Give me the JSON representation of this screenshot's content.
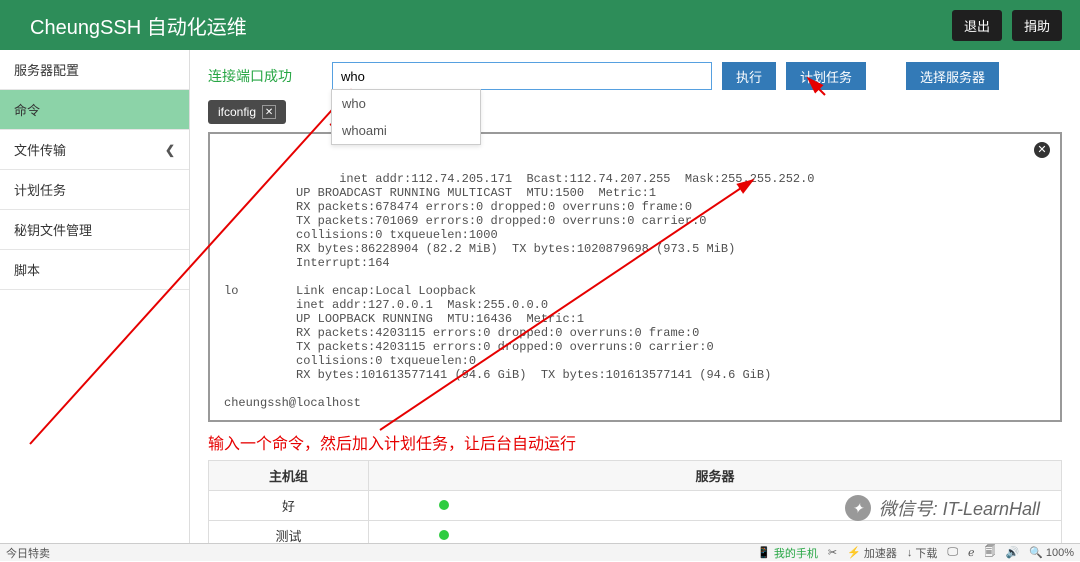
{
  "header": {
    "brand": "CheungSSH 自动化运维",
    "logout": "退出",
    "donate": "捐助"
  },
  "sidebar": {
    "items": [
      {
        "label": "服务器配置"
      },
      {
        "label": "命令",
        "active": true
      },
      {
        "label": "文件传输",
        "expand": true
      },
      {
        "label": "计划任务"
      },
      {
        "label": "秘钥文件管理"
      },
      {
        "label": "脚本"
      }
    ]
  },
  "top": {
    "status": "连接端口成功",
    "input_value": "who",
    "run": "执行",
    "sched": "计划任务",
    "select_server": "选择服务器"
  },
  "autocomplete": [
    "who",
    "whoami"
  ],
  "tag": {
    "label": "ifconfig"
  },
  "terminal_text": "          inet addr:112.74.205.171  Bcast:112.74.207.255  Mask:255.255.252.0\n          UP BROADCAST RUNNING MULTICAST  MTU:1500  Metric:1\n          RX packets:678474 errors:0 dropped:0 overruns:0 frame:0\n          TX packets:701069 errors:0 dropped:0 overruns:0 carrier:0\n          collisions:0 txqueuelen:1000\n          RX bytes:86228904 (82.2 MiB)  TX bytes:1020879698 (973.5 MiB)\n          Interrupt:164\n\nlo        Link encap:Local Loopback\n          inet addr:127.0.0.1  Mask:255.0.0.0\n          UP LOOPBACK RUNNING  MTU:16436  Metric:1\n          RX packets:4203115 errors:0 dropped:0 overruns:0 frame:0\n          TX packets:4203115 errors:0 dropped:0 overruns:0 carrier:0\n          collisions:0 txqueuelen:0\n          RX bytes:101613577141 (94.6 GiB)  TX bytes:101613577141 (94.6 GiB)\n\ncheungssh@localhost",
  "annotation": "输入一个命令，然后加入计划任务，让后台自动运行",
  "table": {
    "cols": [
      "主机组",
      "服务器"
    ],
    "rows": [
      {
        "group": "好",
        "online": true
      },
      {
        "group": "测试",
        "online": true
      }
    ]
  },
  "statusbar": {
    "left": "今日特卖",
    "phone": "我的手机",
    "accel": "加速器",
    "download": "下载",
    "zoom": "100%"
  },
  "wechat": {
    "label": "微信号: IT-LearnHall"
  }
}
